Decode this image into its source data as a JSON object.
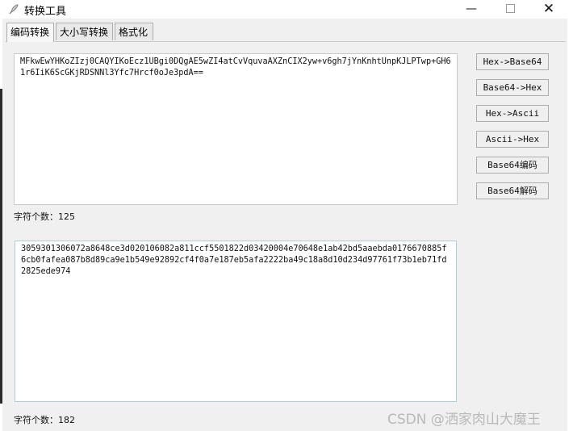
{
  "window": {
    "title": "转换工具",
    "minimize_glyph": "—",
    "close_glyph": "✕"
  },
  "tabs": [
    {
      "label": "编码转换",
      "active": true
    },
    {
      "label": "大小写转换",
      "active": false
    },
    {
      "label": "格式化",
      "active": false
    }
  ],
  "input": {
    "value": "MFkwEwYHKoZIzj0CAQYIKoEcz1UBgi0DQgAE5wZI4atCvVquvaAXZnCIX2yw+v6gh7jYnKnhtUnpKJLPTwp+GH61r6IiK6ScGKjRDSNNl3Yfc7Hrcf0oJe3pdA==",
    "char_count_label": "字符个数：125"
  },
  "output": {
    "value": "3059301306072a8648ce3d020106082a811ccf5501822d03420004e70648e1ab42bd5aaebda0176670885f6cb0fafea087b8d89ca9e1b549e92892cf4f0a7e187eb5afa2222ba49c18a8d10d234d97761f73b1eb71fd2825ede974",
    "char_count_label": "字符个数：182"
  },
  "buttons": {
    "hex_to_base64": "Hex->Base64",
    "base64_to_hex": "Base64->Hex",
    "hex_to_ascii": "Hex->Ascii",
    "ascii_to_hex": "Ascii->Hex",
    "base64_encode": "Base64编码",
    "base64_decode": "Base64解码"
  },
  "watermark": "CSDN @洒家肉山大魔王",
  "colors": {
    "window_bg": "#f0f0f0",
    "output_border": "#a9cfe3"
  }
}
